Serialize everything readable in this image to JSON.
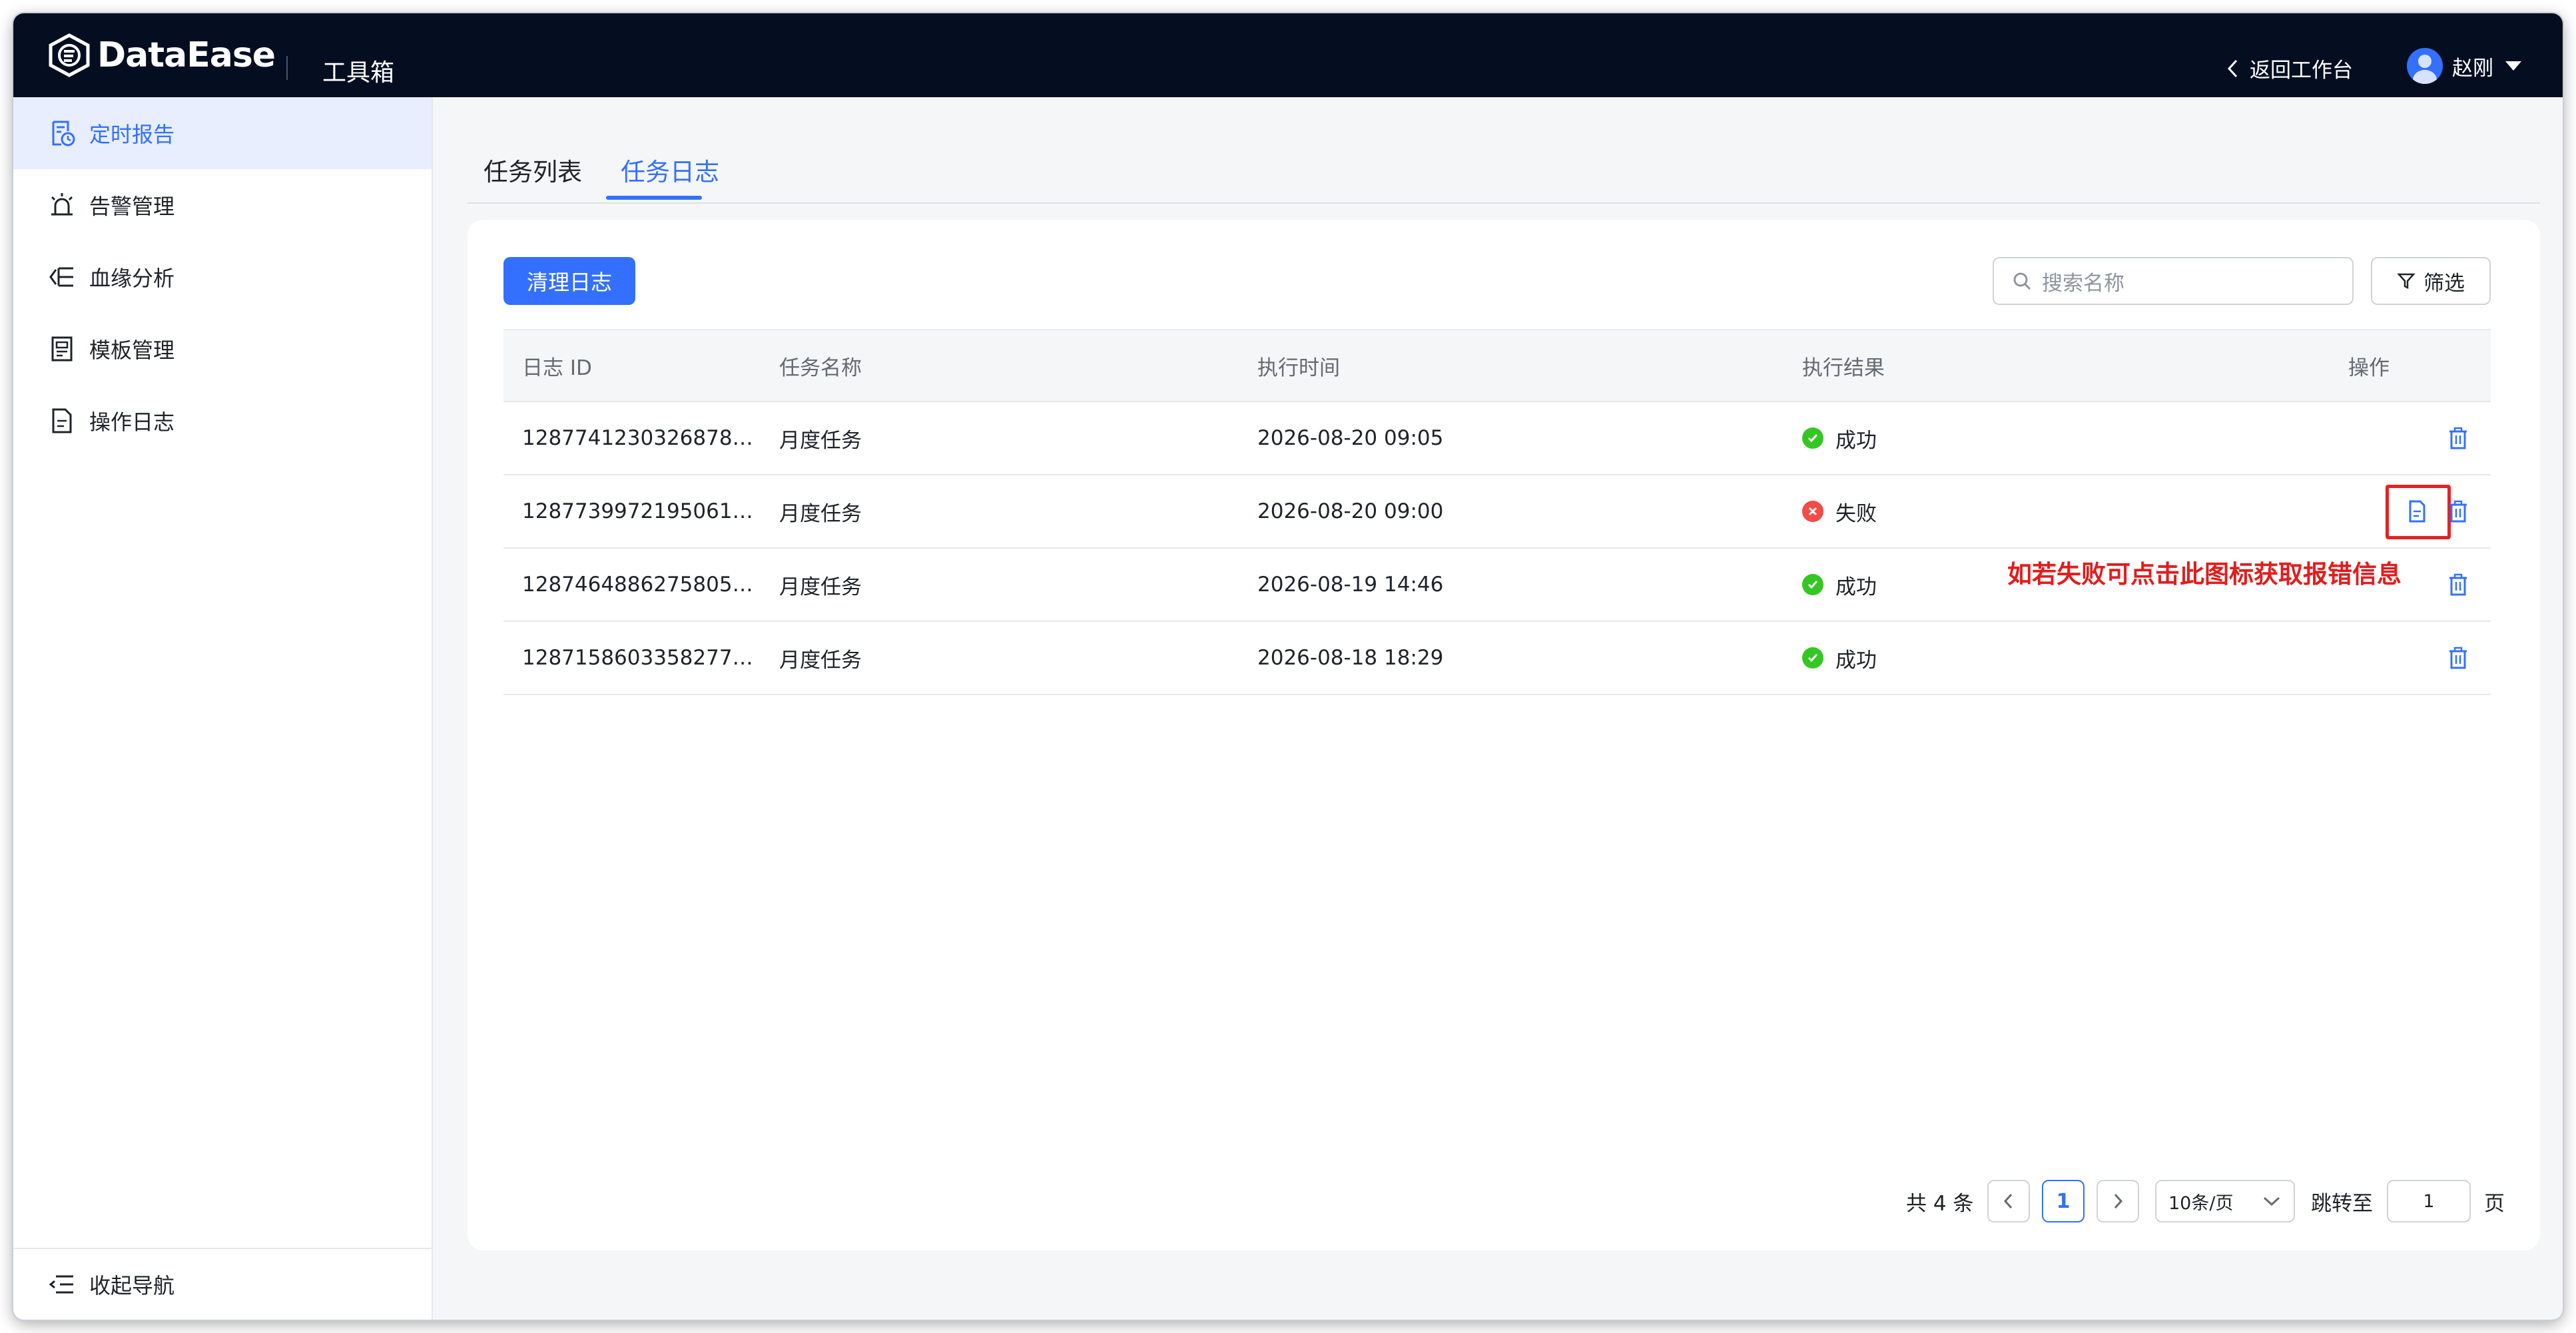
{
  "header": {
    "brand": "DataEase",
    "section_title": "工具箱",
    "back_label": "返回工作台",
    "user_name": "赵刚"
  },
  "sidebar": {
    "items": [
      {
        "label": "定时报告",
        "icon": "scheduled-report-icon",
        "active": true
      },
      {
        "label": "告警管理",
        "icon": "alarm-icon",
        "active": false
      },
      {
        "label": "血缘分析",
        "icon": "lineage-icon",
        "active": false
      },
      {
        "label": "模板管理",
        "icon": "template-icon",
        "active": false
      },
      {
        "label": "操作日志",
        "icon": "operation-log-icon",
        "active": false
      }
    ],
    "collapse_label": "收起导航"
  },
  "tabs": [
    {
      "label": "任务列表",
      "active": false
    },
    {
      "label": "任务日志",
      "active": true
    }
  ],
  "toolbar": {
    "clear_label": "清理日志",
    "search_placeholder": "搜索名称",
    "filter_label": "筛选"
  },
  "table": {
    "columns": [
      "日志 ID",
      "任务名称",
      "执行时间",
      "执行结果",
      "操作"
    ],
    "rows": [
      {
        "id": "1287741230326878…",
        "name": "月度任务",
        "time": "2026-08-20 09:05",
        "result": "成功",
        "status": "success"
      },
      {
        "id": "1287739972195061…",
        "name": "月度任务",
        "time": "2026-08-20 09:00",
        "result": "失败",
        "status": "fail"
      },
      {
        "id": "1287464886275805…",
        "name": "月度任务",
        "time": "2026-08-19 14:46",
        "result": "成功",
        "status": "success"
      },
      {
        "id": "1287158603358277…",
        "name": "月度任务",
        "time": "2026-08-18 18:29",
        "result": "成功",
        "status": "success"
      }
    ]
  },
  "annotation": "如若失败可点击此图标获取报错信息",
  "pagination": {
    "total_label": "共 4 条",
    "current_page": "1",
    "page_size": "10条/页",
    "goto_label": "跳转至",
    "goto_value": "1",
    "page_suffix": "页"
  },
  "colors": {
    "accent": "#3370ff",
    "header_bg": "#050e21",
    "success": "#34c724",
    "fail": "#f54a45",
    "annotation": "#e31c1c"
  }
}
